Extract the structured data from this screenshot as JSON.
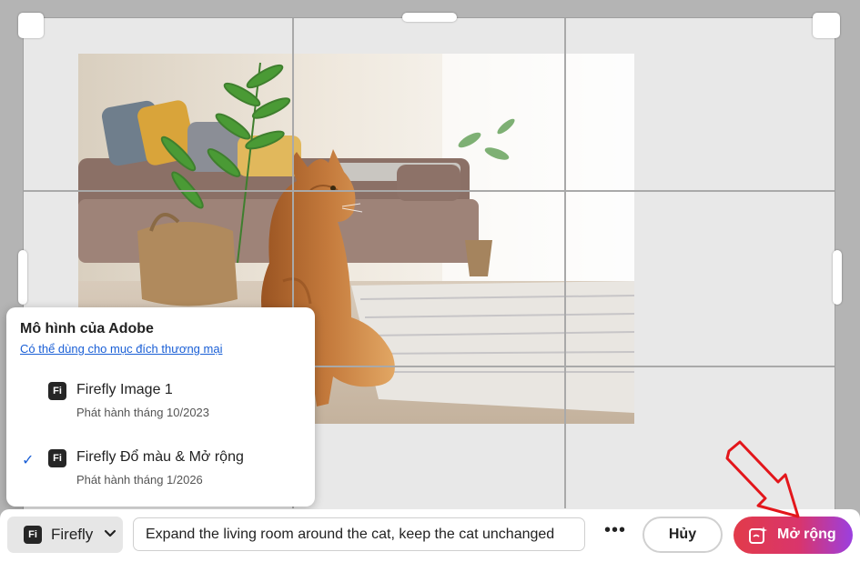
{
  "model_popover": {
    "title": "Mô hình của Adobe",
    "link": "Có thể dùng cho mục đích thương mại",
    "models": [
      {
        "badge": "Fi",
        "name": "Firefly Image 1",
        "release": "Phát hành tháng 10/2023",
        "selected": false
      },
      {
        "badge": "Fi",
        "name": "Firefly Đổ màu & Mở rộng",
        "release": "Phát hành tháng 1/2026",
        "selected": true
      }
    ],
    "check_icon": "checkmark-icon"
  },
  "toolbar": {
    "model_badge": "Fi",
    "model_label": "Firefly",
    "prompt_value": "Expand the living room around the cat, keep the cat unchanged",
    "more_label": "•••",
    "cancel_label": "Hủy",
    "expand_label": "Mở rộng",
    "expand_icon": "generative-expand-icon"
  },
  "colors": {
    "link": "#1a5fd6",
    "expand_gradient_start": "#e23b4a",
    "expand_gradient_end": "#9b3fe0",
    "annotation_arrow": "#e3161b"
  }
}
